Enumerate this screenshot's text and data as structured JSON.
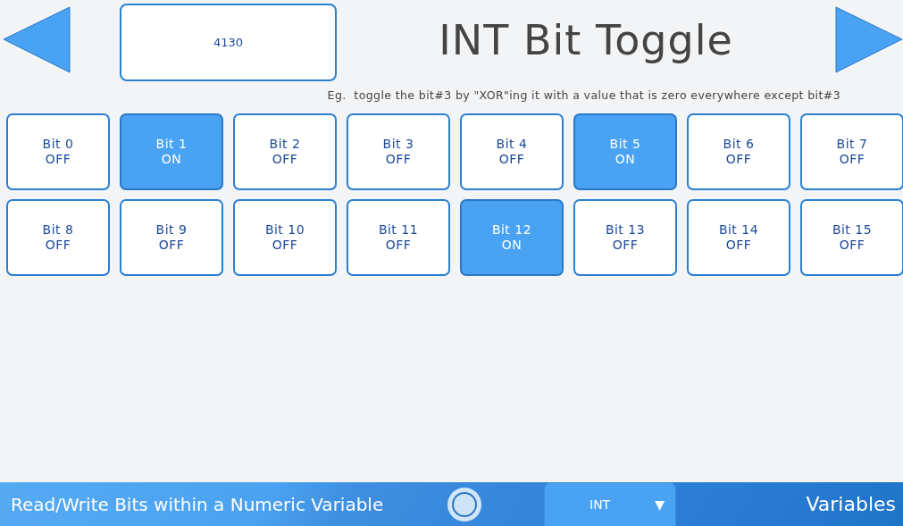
{
  "header": {
    "value": "4130",
    "title": "INT Bit Toggle",
    "hint": "Eg.  toggle the bit#3 by \"XOR\"ing it with a value that is zero everywhere except bit#3"
  },
  "bits": [
    {
      "label": "Bit 0",
      "state": "OFF",
      "on": false
    },
    {
      "label": "Bit 1",
      "state": "ON",
      "on": true
    },
    {
      "label": "Bit 2",
      "state": "OFF",
      "on": false
    },
    {
      "label": "Bit 3",
      "state": "OFF",
      "on": false
    },
    {
      "label": "Bit 4",
      "state": "OFF",
      "on": false
    },
    {
      "label": "Bit 5",
      "state": "ON",
      "on": true
    },
    {
      "label": "Bit 6",
      "state": "OFF",
      "on": false
    },
    {
      "label": "Bit 7",
      "state": "OFF",
      "on": false
    },
    {
      "label": "Bit 8",
      "state": "OFF",
      "on": false
    },
    {
      "label": "Bit 9",
      "state": "OFF",
      "on": false
    },
    {
      "label": "Bit 10",
      "state": "OFF",
      "on": false
    },
    {
      "label": "Bit 11",
      "state": "OFF",
      "on": false
    },
    {
      "label": "Bit 12",
      "state": "ON",
      "on": true
    },
    {
      "label": "Bit 13",
      "state": "OFF",
      "on": false
    },
    {
      "label": "Bit 14",
      "state": "OFF",
      "on": false
    },
    {
      "label": "Bit 15",
      "state": "OFF",
      "on": false
    }
  ],
  "status_bar": {
    "caption": "Read/Write Bits within a Numeric Variable",
    "dropdown": {
      "value": "INT",
      "caret": "▼"
    },
    "section": "Variables"
  }
}
